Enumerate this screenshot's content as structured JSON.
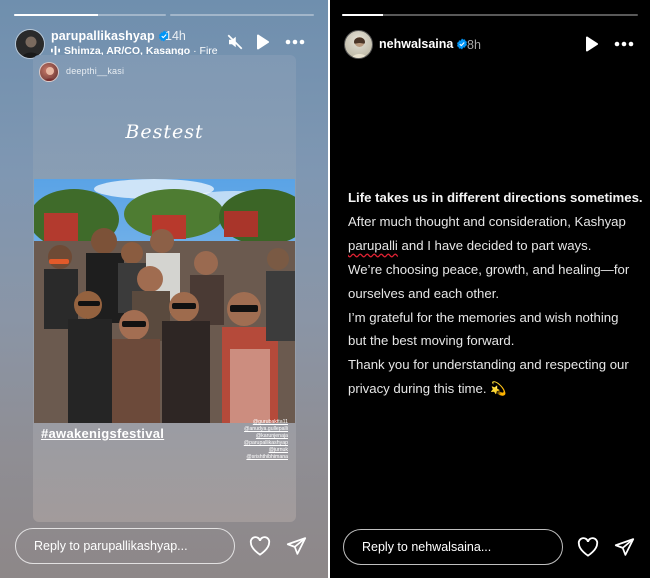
{
  "left_story": {
    "username": "parupallikashyap",
    "time": "14h",
    "music": {
      "title": "Shimza, AR/CO, Kasango",
      "sub": "· Fire"
    },
    "progress": 0.55,
    "shared_post": {
      "username": "deepthi__kasi",
      "caption": "Bestest",
      "hashtag": "#awakenigsfestival",
      "mentions": [
        "@gurubaktta11",
        "@anudya.gullepalli",
        "@karunjenaja",
        "@parupallikashyap",
        "@jurnuk",
        "@srishthibhimana"
      ]
    },
    "reply_placeholder": "Reply to parupallikashyap..."
  },
  "right_story": {
    "username": "nehwalsaina",
    "time": "8h",
    "progress": 0.14,
    "message_lines": [
      "Life takes us in different directions sometimes.",
      "After much thought and consideration, Kashyap",
      "parupalli",
      " and I have decided to part ways.",
      "We’re choosing peace, growth, and healing—for",
      "ourselves and each other.",
      "I’m grateful for the memories and wish nothing",
      "but the best moving forward.",
      "Thank you for understanding and respecting our",
      "privacy during this time. 💫"
    ],
    "reply_placeholder": "Reply to nehwalsaina..."
  },
  "icons": {
    "verified": "verified-badge-icon",
    "mute": "speaker-muted-icon",
    "play": "play-icon",
    "more": "more-horizontal-icon",
    "like": "heart-icon",
    "share": "send-icon"
  },
  "colors": {
    "verified_blue": "#0095f6",
    "story_right_bg": "#000000"
  }
}
